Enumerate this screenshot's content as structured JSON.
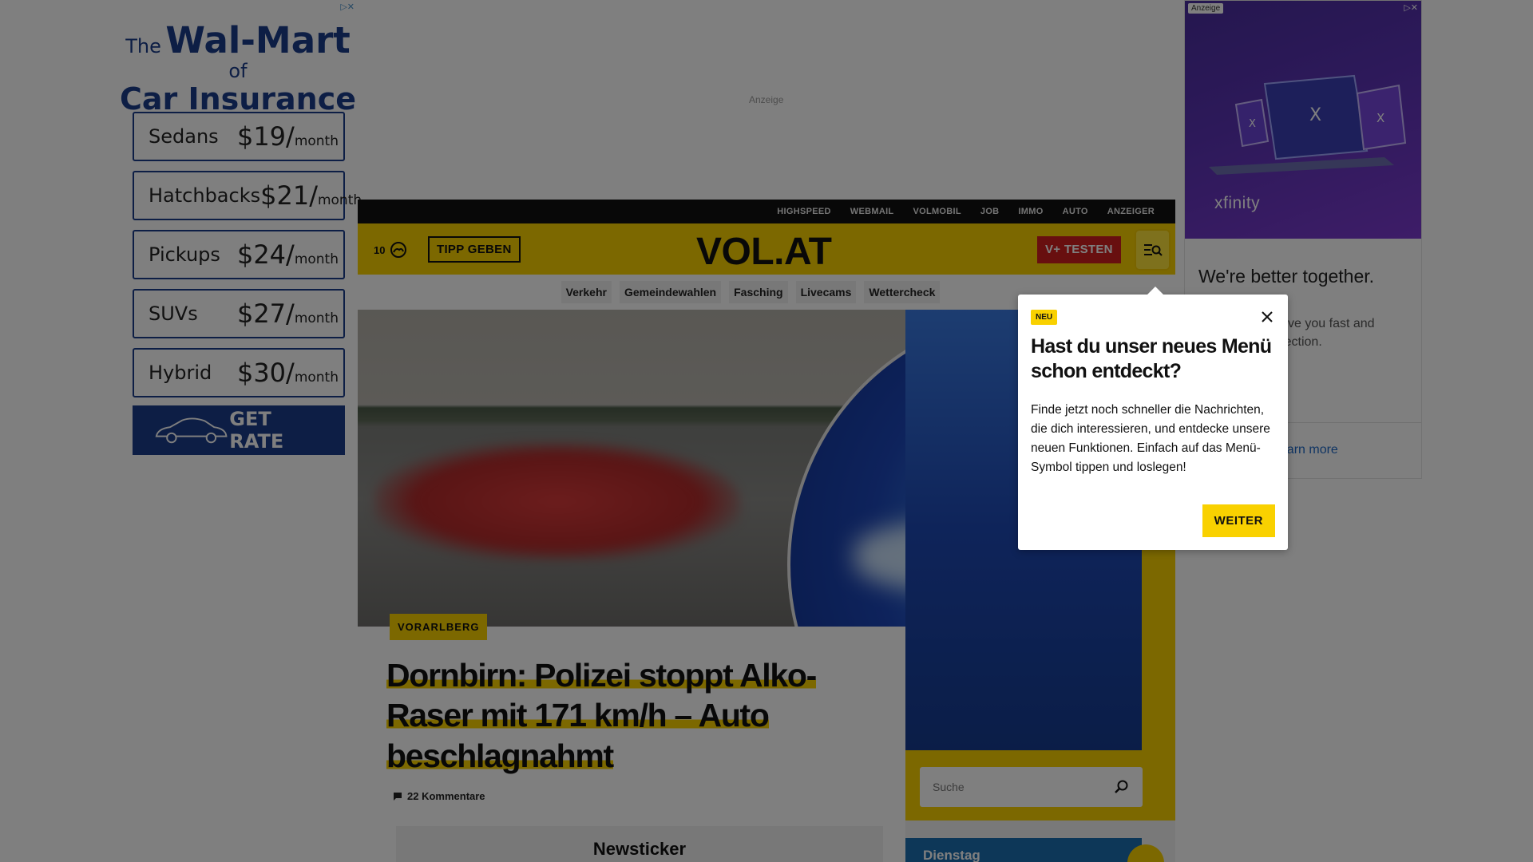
{
  "ad_left": {
    "adchoices": "▷✕",
    "headline_pre": "The",
    "headline_brand": "Wal-Mart",
    "headline_post": "of",
    "headline_line2": "Car Insurance",
    "rates": [
      {
        "label": "Sedans",
        "price": "$19/",
        "per": "month"
      },
      {
        "label": "Hatchbacks",
        "price": "$21/",
        "per": "month"
      },
      {
        "label": "Pickups",
        "price": "$24/",
        "per": "month"
      },
      {
        "label": "SUVs",
        "price": "$27/",
        "per": "month"
      },
      {
        "label": "Hybrid",
        "price": "$30/",
        "per": "month"
      }
    ],
    "cta": "GET RATE",
    "brand_color": "#1a3c8a"
  },
  "ad_top": {
    "label": "Anzeige"
  },
  "ad_right": {
    "badge": "Anzeige",
    "choices": "▷✕",
    "brand": "xfinity",
    "tagline": "We're better together.",
    "body": "Xfinity Mobile give you fast and incredible connection.",
    "learn_more": "Learn more"
  },
  "topbar": {
    "links": [
      "HIGHSPEED",
      "WEBMAIL",
      "VOLMOBIL",
      "JOB",
      "IMMO",
      "AUTO",
      "ANZEIGER"
    ]
  },
  "header": {
    "temperature": "10",
    "weather_icon": "cloud-icon",
    "tipp_label": "TIPP GEBEN",
    "logo": "VOL.AT",
    "vplus_label": "V+ TESTEN",
    "menu_icon": "menu-search-icon",
    "accent": "#f9d100"
  },
  "subnav": {
    "items": [
      "Verkehr",
      "Gemeindewahlen",
      "Fasching",
      "Livecams",
      "Wettercheck"
    ]
  },
  "article": {
    "kicker": "VORARLBERG",
    "headline": "Dornbirn: Polizei stoppt Alko-Raser mit 171 km/h – Auto beschlagnahmt",
    "comments": "22 Kommentare"
  },
  "search": {
    "placeholder": "Suche"
  },
  "newsticker": {
    "title": "Newsticker"
  },
  "day_card": {
    "label": "Dienstag"
  },
  "popover": {
    "badge": "NEU",
    "title": "Hast du unser neues Menü schon entdeckt?",
    "text": "Finde jetzt noch schneller die Nachrichten, die dich interessieren, und entdecke unsere neuen Funktionen. Einfach auf das Menü-Symbol tippen und loslegen!",
    "button": "WEITER"
  }
}
